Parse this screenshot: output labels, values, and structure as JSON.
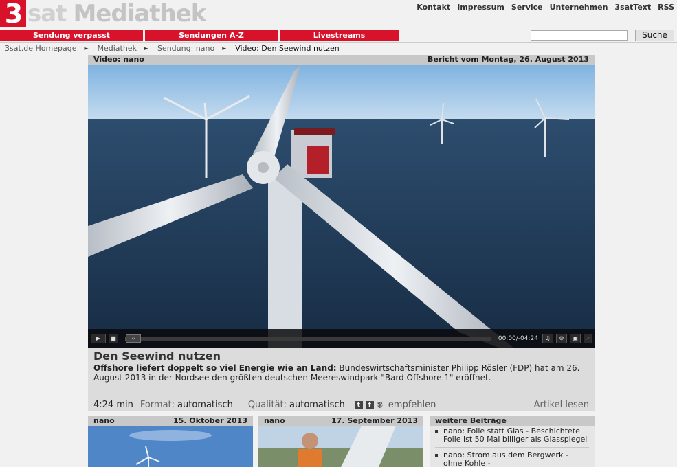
{
  "brand": {
    "logo_number": "3",
    "logo_name": "sat",
    "logo_section": "Mediathek",
    "accent": "#d9122b"
  },
  "top_links": [
    "Kontakt",
    "Impressum",
    "Service",
    "Unternehmen",
    "3satText",
    "RSS"
  ],
  "nav": [
    "Sendung verpasst",
    "Sendungen A-Z",
    "Livestreams"
  ],
  "search": {
    "value": "",
    "button_label": "Suche"
  },
  "breadcrumb": [
    "3sat.de Homepage",
    "Mediathek",
    "Sendung: nano",
    "Video: Den Seewind nutzen"
  ],
  "video": {
    "header_left": "Video: nano",
    "header_right": "Bericht vom Montag, 26. August 2013",
    "timecode": "00:00/-04:24",
    "progress": 0,
    "title": "Den Seewind nutzen",
    "lead": "Offshore liefert doppelt so viel Energie wie an Land:",
    "description": " Bundeswirtschaftsminister Philipp Rösler (FDP) hat am 26. August 2013 in der Nordsee den größten deutschen Meereswindpark \"Bard Offshore 1\" eröffnet.",
    "duration": "4:24 min",
    "format_label": "Format:",
    "format_value": "automatisch",
    "quality_label": "Qualität:",
    "quality_value": "automatisch",
    "share_icons": [
      "twitter-icon",
      "facebook-icon",
      "gear-icon"
    ],
    "recommend_label": "empfehlen",
    "read_label": "Artikel lesen"
  },
  "teasers": [
    {
      "show": "nano",
      "date": "15. Oktober 2013"
    },
    {
      "show": "nano",
      "date": "17. September 2013"
    }
  ],
  "more": {
    "title": "weitere Beiträge",
    "items": [
      "nano: Folie statt Glas - Beschichtete Folie ist 50 Mal billiger als Glasspiegel",
      "nano: Strom aus dem Bergwerk - ohne Kohle -"
    ]
  }
}
